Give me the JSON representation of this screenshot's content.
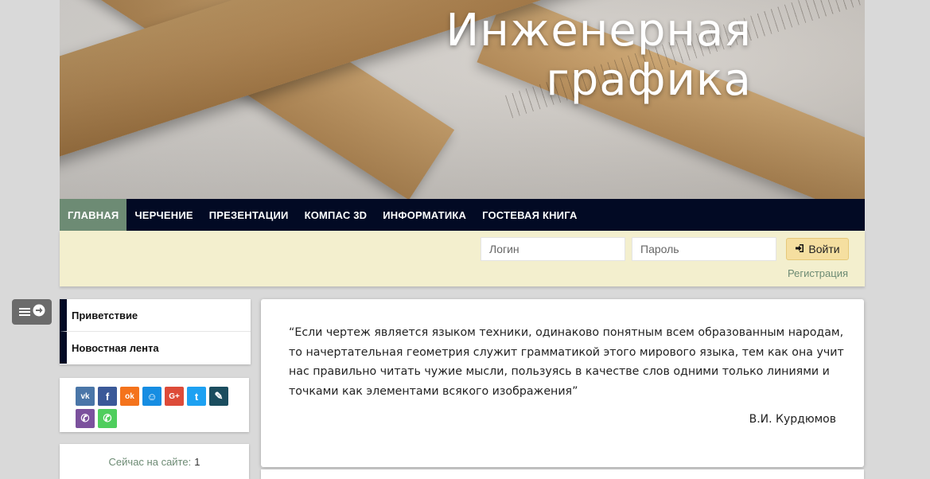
{
  "site": {
    "title_line1": "Инженерная",
    "title_line2": "графика"
  },
  "nav": {
    "items": [
      {
        "label": "ГЛАВНАЯ",
        "active": true
      },
      {
        "label": "ЧЕРЧЕНИЕ",
        "active": false
      },
      {
        "label": "ПРЕЗЕНТАЦИИ",
        "active": false
      },
      {
        "label": "КОМПАС 3D",
        "active": false
      },
      {
        "label": "ИНФОРМАТИКА",
        "active": false
      },
      {
        "label": "ГОСТЕВАЯ КНИГА",
        "active": false
      }
    ]
  },
  "login": {
    "login_placeholder": "Логин",
    "password_placeholder": "Пароль",
    "submit_label": "Войти",
    "register_label": "Регистрация"
  },
  "sidebar": {
    "menu": [
      {
        "label": "Приветствие"
      },
      {
        "label": "Новостная лента"
      }
    ],
    "share": [
      {
        "icon": "vk-icon",
        "glyph": "vk",
        "color": "#4a76a8"
      },
      {
        "icon": "facebook-icon",
        "glyph": "f",
        "color": "#3b5998"
      },
      {
        "icon": "odnoklassniki-icon",
        "glyph": "ok",
        "color": "#f4731c"
      },
      {
        "icon": "moimir-icon",
        "glyph": "☺",
        "color": "#168de2"
      },
      {
        "icon": "googleplus-icon",
        "glyph": "G+",
        "color": "#dd4b39"
      },
      {
        "icon": "twitter-icon",
        "glyph": "t",
        "color": "#1da1f2"
      },
      {
        "icon": "livejournal-icon",
        "glyph": "✎",
        "color": "#1b4d5f"
      },
      {
        "icon": "viber-icon",
        "glyph": "✆",
        "color": "#7b519d"
      },
      {
        "icon": "whatsapp-icon",
        "glyph": "✆",
        "color": "#4fce5d"
      }
    ],
    "online_label": "Сейчас на сайте:",
    "online_count": "1"
  },
  "main": {
    "quote": "“Если чертеж является языком техники, одинаково понятным всем образованным народам, то начертательная геометрия служит грамматикой этого мирового языка, тем как она учит нас правильно читать чужие мысли, пользуясь в качестве слов одними только линиями и точками как элементами всякого изображения”",
    "author": "В.И. Курдюмов"
  },
  "colors": {
    "nav_bg": "#020a24",
    "nav_active": "#6d8b74",
    "login_bar_bg": "#f3efce",
    "login_button": "#f5dfa0"
  }
}
